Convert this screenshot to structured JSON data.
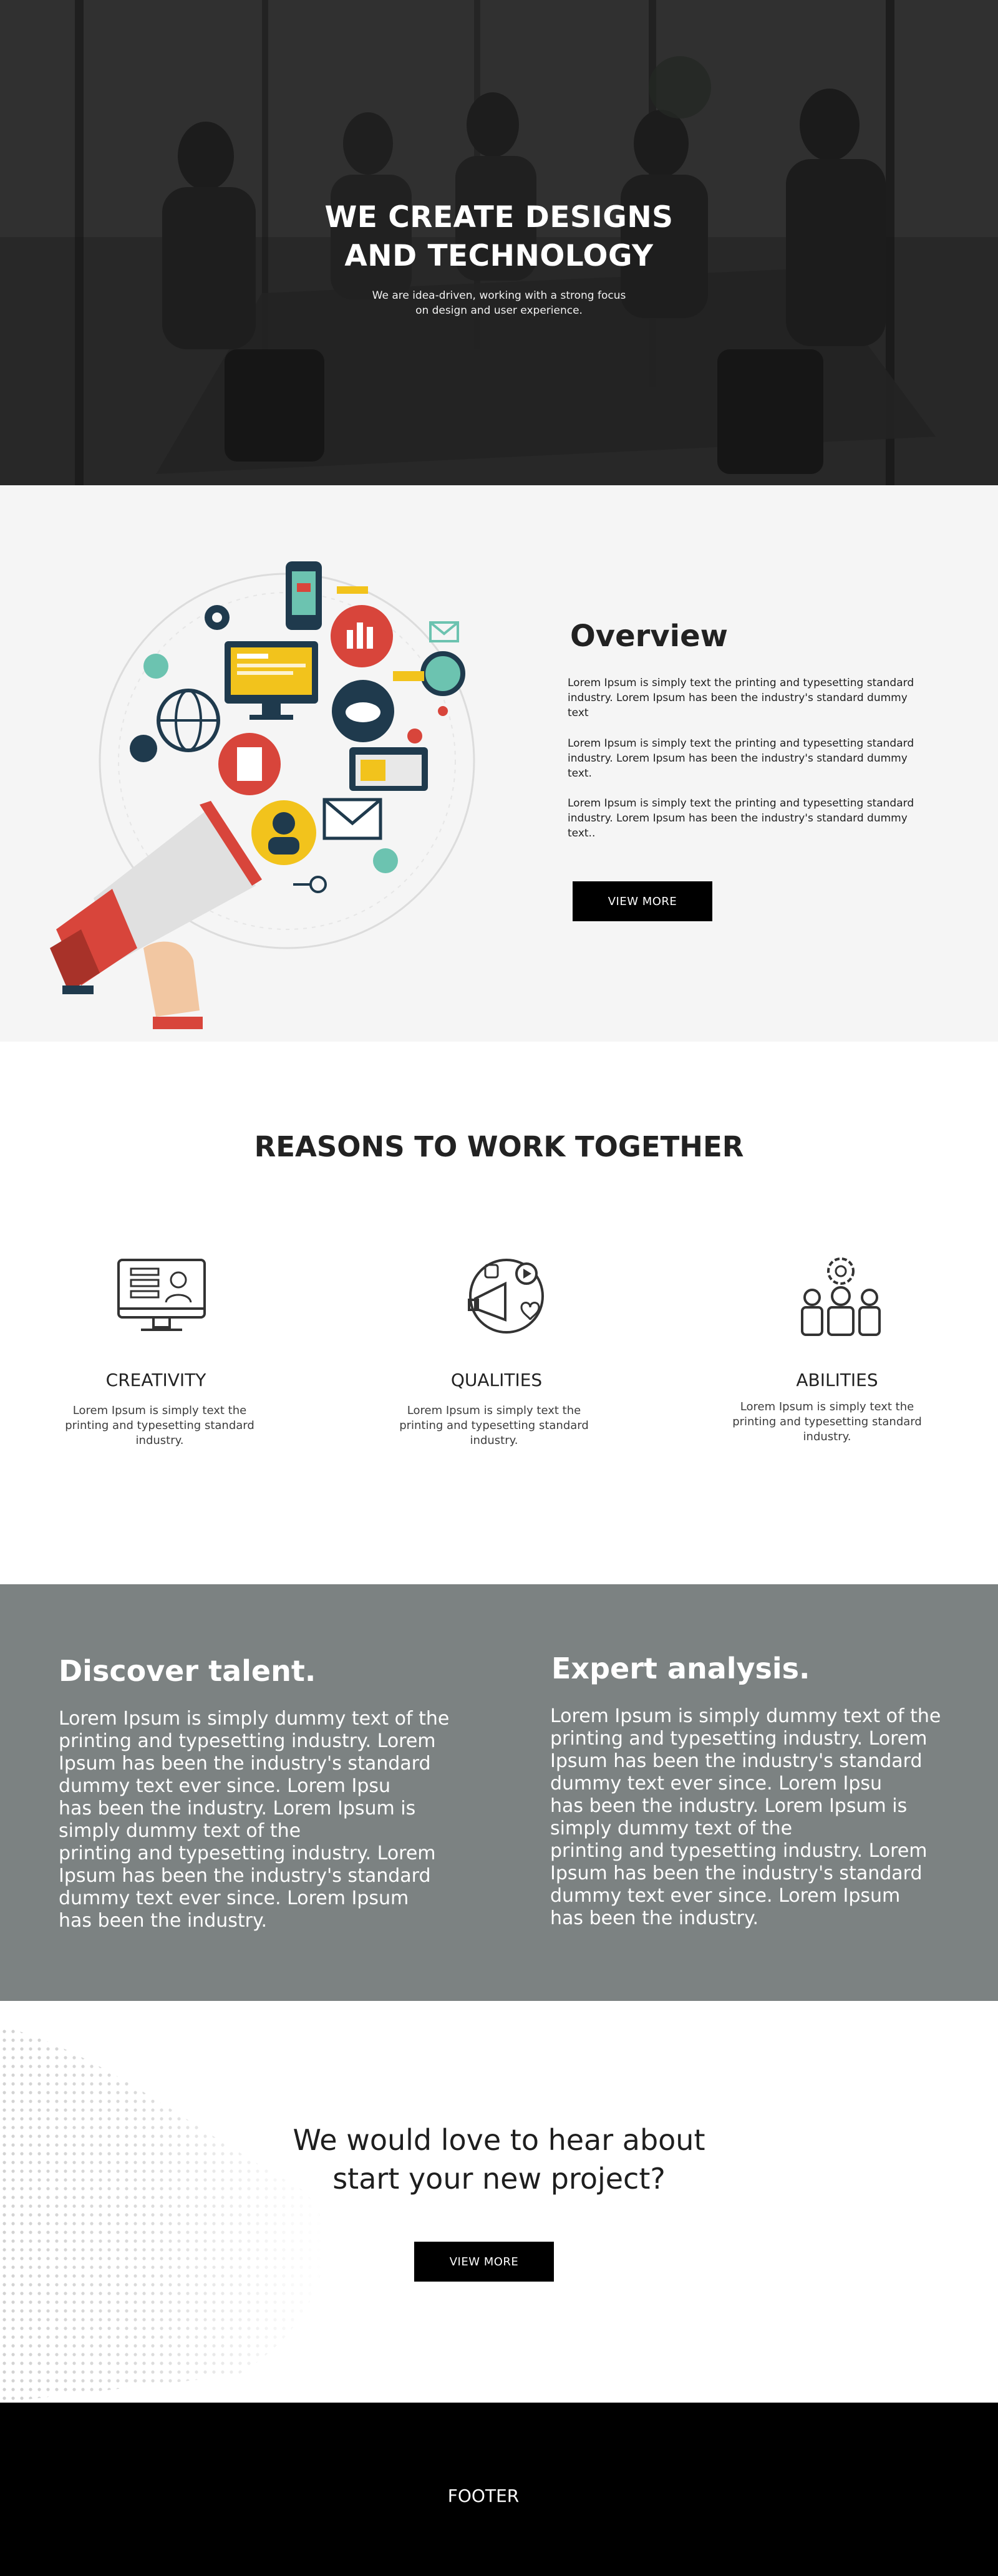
{
  "hero": {
    "title": "WE CREATE DESIGNS\nAND TECHNOLOGY",
    "subtitle": "We are idea-driven, working with a strong focus\non design and user experience."
  },
  "overview": {
    "title": "Overview",
    "paragraphs": [
      "Lorem Ipsum is simply text the printing and typesetting standard industry. Lorem Ipsum has been the industry's standard dummy text",
      "Lorem Ipsum is simply text the printing and typesetting standard industry. Lorem Ipsum has been the industry's standard dummy text.",
      "Lorem Ipsum is simply text the printing and typesetting standard industry. Lorem Ipsum has been the industry's standard dummy text.."
    ],
    "button": "VIEW MORE",
    "illustration_icon": "digital-marketing-megaphone-illustration"
  },
  "reasons": {
    "title": "REASONS TO WORK TOGETHER",
    "items": [
      {
        "name": "CREATIVITY",
        "text": "Lorem Ipsum is simply text the printing and typesetting standard industry.",
        "icon": "monitor-profile-icon"
      },
      {
        "name": "QUALITIES",
        "text": "Lorem Ipsum is simply text the printing and typesetting standard industry.",
        "icon": "social-megaphone-icon"
      },
      {
        "name": "ABILITIES",
        "text": "Lorem Ipsum is simply text the printing and typesetting standard industry.",
        "icon": "team-gear-icon"
      }
    ]
  },
  "discover": {
    "left": {
      "heading": "Discover talent.",
      "body": "Lorem Ipsum is simply dummy text of the\nprinting and typesetting industry. Lorem\nIpsum has been the industry's standard\ndummy text ever since. Lorem Ipsu\nhas been the industry. Lorem Ipsum is\nsimply dummy text of the\nprinting and typesetting industry. Lorem\nIpsum has been the industry's standard\ndummy text ever since. Lorem Ipsum\nhas been the industry."
    },
    "right": {
      "heading": "Expert analysis.",
      "body": "Lorem Ipsum is simply dummy text of the\nprinting and typesetting industry. Lorem\nIpsum has been the industry's standard\ndummy text ever since. Lorem Ipsu\nhas been the industry. Lorem Ipsum is\nsimply dummy text of the\nprinting and typesetting industry. Lorem\nIpsum has been the industry's standard\ndummy text ever since. Lorem Ipsum\nhas been the industry."
    }
  },
  "cta": {
    "text": "We would love to hear about\nstart your new project?",
    "button": "VIEW MORE"
  },
  "footer": {
    "text": "FOOTER"
  },
  "colors": {
    "hero_overlay": "#2e2e2e",
    "overview_bg": "#f5f5f5",
    "discover_bg": "#7c8282",
    "footer_bg": "#000000",
    "accent_red": "#d8453b",
    "accent_teal": "#6cc3b0",
    "accent_navy": "#1f3a4d",
    "accent_yellow": "#f2c31c"
  }
}
